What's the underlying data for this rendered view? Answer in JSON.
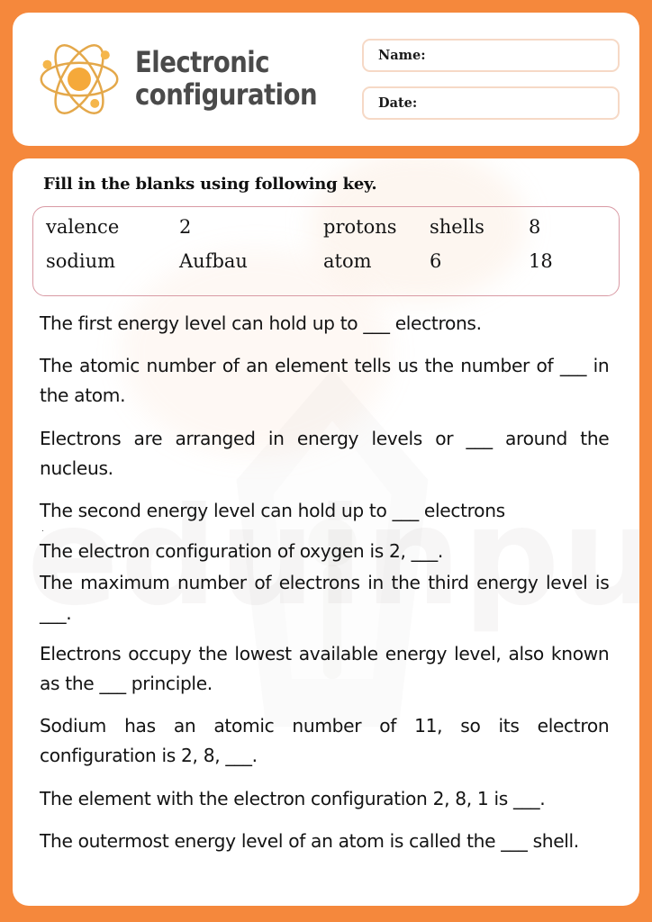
{
  "theme": {
    "page_background": "#F5883C",
    "card_background": "#FFFFFF",
    "title_color": "#4A4A4A",
    "logo_color": "#E8A33D",
    "field_border": "#F6D9C6",
    "key_border": "#D99AA4",
    "text_color": "#131313"
  },
  "header": {
    "logo_icon": "atom-icon",
    "title": "Electronic\nconfiguration",
    "fields": [
      {
        "label": "Name:",
        "value": "",
        "placeholder": ""
      },
      {
        "label": "Date:",
        "value": "",
        "placeholder": ""
      }
    ]
  },
  "worksheet": {
    "instruction": "Fill in the blanks using following key.",
    "key": {
      "rows": [
        [
          "valence",
          "2",
          "protons",
          "shells",
          "8"
        ],
        [
          "sodium",
          "Aufbau",
          "atom",
          "6",
          "18"
        ]
      ]
    },
    "questions": [
      "The first energy level can hold up to ___ electrons.",
      "The atomic number of an element tells us the number of ___ in the atom.",
      "Electrons are arranged in energy levels or ___ around the nucleus.",
      "The second energy level can hold up to ___ electrons",
      "The electron configuration of oxygen is 2, ___.",
      "The maximum number of electrons in the third energy level is ___.",
      "Electrons occupy the lowest available energy level, also known as the ___ principle.",
      "Sodium has an atomic number of 11, so its electron configuration is 2, 8, ___.",
      "The element with the electron configuration 2, 8, 1 is ___.",
      "The outermost energy level of an atom is called the ___ shell."
    ],
    "stray_mark": "."
  },
  "watermark": {
    "text": "eduinput.com",
    "graphic": "pen-nib-icon"
  }
}
